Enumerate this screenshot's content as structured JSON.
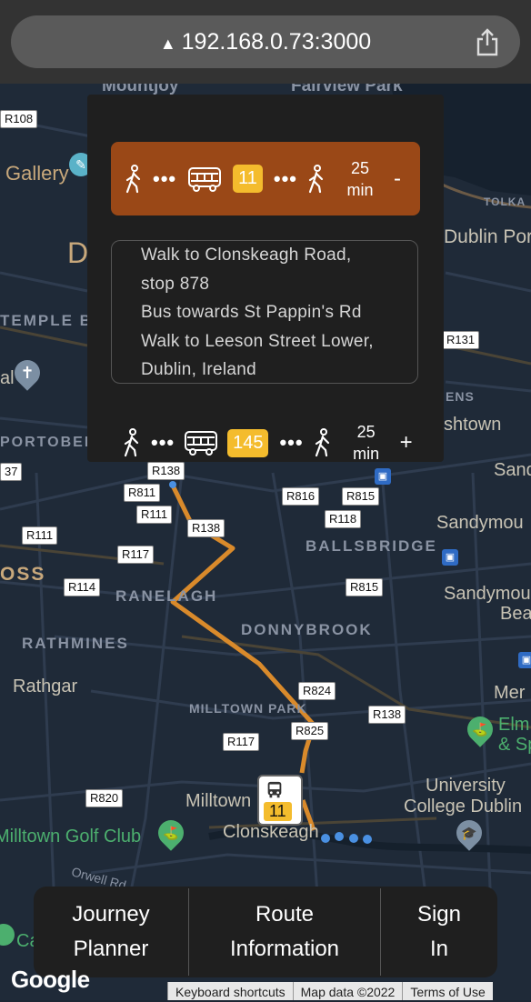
{
  "browser": {
    "url": "192.168.0.73:3000",
    "warning_icon": "warning-triangle-icon",
    "share_icon": "share-icon"
  },
  "map": {
    "areas": [
      "Mountjoy",
      "Fairview Park",
      "TEMPLE B",
      "PORTOBELL",
      "RANELAGH",
      "BALLSBRIDGE",
      "DONNYBROOK",
      "RATHMINES",
      "MILLTOWN PARK",
      "OSS",
      "ENS",
      "TOLKA"
    ],
    "places": [
      "Gallery",
      "Dublin Por",
      "Rathgar",
      "Milltown",
      "Clonskeagh",
      "Sandymou",
      "Mer",
      "Sand",
      "shtown",
      "University",
      "College Dublin",
      "Milltown Golf Club",
      "Elm",
      "& Sp",
      "Orwell Rd",
      "Bea",
      "D",
      "al",
      "Ca"
    ],
    "roads": [
      "R108",
      "R131",
      "R138",
      "R811",
      "R816",
      "R815",
      "R118",
      "R111",
      "R111",
      "R138",
      "R117",
      "R114",
      "R815",
      "R824",
      "R825",
      "R138",
      "R117",
      "R820",
      "37"
    ]
  },
  "route_options": [
    {
      "bus_number": "11",
      "duration_value": "25",
      "duration_unit": "min",
      "toggle": "-",
      "directions": [
        "Walk to Clonskeagh Road,",
        "stop 878",
        "Bus towards St Pappin's Rd",
        "Walk to Leeson Street Lower,",
        "Dublin, Ireland"
      ]
    },
    {
      "bus_number": "145",
      "duration_value": "25",
      "duration_unit": "min",
      "toggle": "+"
    }
  ],
  "walk_dots": "•••",
  "route_marker": {
    "bus_number": "11"
  },
  "nav": {
    "journey_planner_line1": "Journey",
    "journey_planner_line2": "Planner",
    "route_information_line1": "Route",
    "route_information_line2": "Information",
    "sign_in_line1": "Sign",
    "sign_in_line2": "In"
  },
  "attribution": {
    "logo": "Google",
    "keyboard": "Keyboard shortcuts",
    "mapdata": "Map data ©2022",
    "terms": "Terms of Use"
  },
  "colors": {
    "route_line": "#d98a2b",
    "selected_route_bg": "#9a4817",
    "bus_badge": "#f4bc2d",
    "panel_bg": "#1f1f1f"
  }
}
